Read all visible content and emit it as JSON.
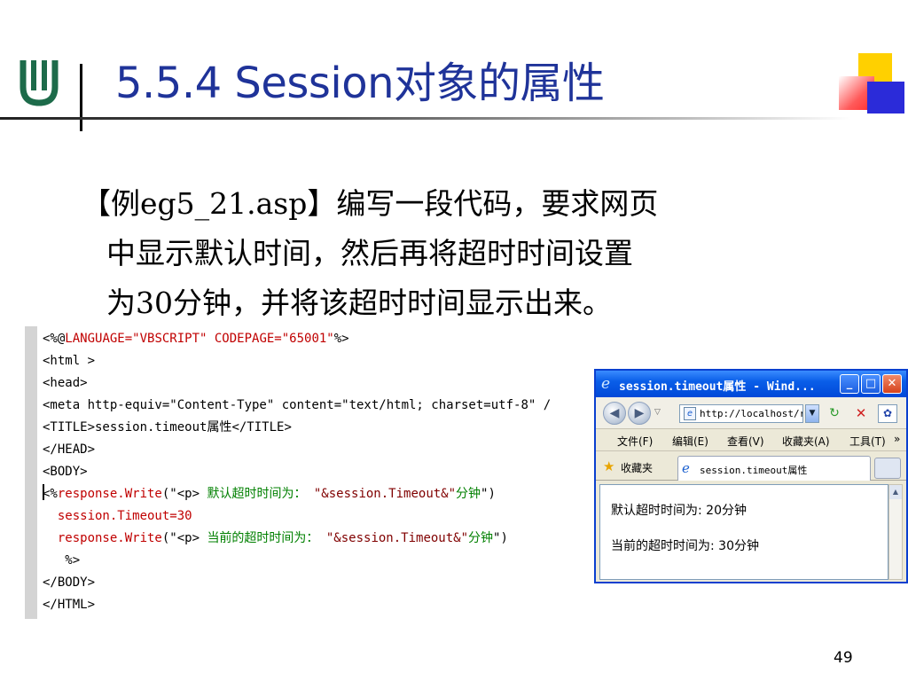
{
  "slide": {
    "title": "5.5.4 Session对象的属性",
    "page_number": "49"
  },
  "body": {
    "lines": [
      "【例eg5_21.asp】编写一段代码，要求网页",
      "中显示默认时间，然后再将超时时间设置",
      "为30分钟，并将该超时时间显示出来。"
    ]
  },
  "code": {
    "line1_a": "<%@",
    "line1_b": "LANGUAGE=\"VBSCRIPT\" CODEPAGE=\"65001\"",
    "line1_c": "%>",
    "line2": "<html >",
    "line3": "<head>",
    "line4": "<meta http-equiv=\"Content-Type\" content=\"text/html; charset=utf-8\" /",
    "line5_a": "<TITLE>session.timeout",
    "line5_b": "属性",
    "line5_c": "</TITLE>",
    "line6": "</HEAD>",
    "line7": "<BODY>",
    "line8_a": "<%",
    "line8_b": "response.Write",
    "line8_c": "(\"<p> ",
    "line8_d": "默认超时时间为：",
    "line8_e": " \"&session.Timeout&\"",
    "line8_f": "分钟",
    "line8_g": "\")",
    "line9_a": "  session.Timeout=",
    "line9_b": "30",
    "line10_a": "  response.Write",
    "line10_b": "(\"<p> ",
    "line10_c": "当前的超时时间为：",
    "line10_d": " \"&session.Timeout&\"",
    "line10_e": "分钟",
    "line10_f": "\")",
    "line11": "   %>",
    "line12": "</BODY>",
    "line13": "</HTML>"
  },
  "browser": {
    "title": "session.timeout属性 - Wind...",
    "address": "http://localhost/r",
    "menu": {
      "file": "文件(F)",
      "edit": "编辑(E)",
      "view": "查看(V)",
      "favorites": "收藏夹(A)",
      "tools": "工具(T)",
      "more": "»"
    },
    "favorites_label": "收藏夹",
    "tab_title": "session.timeout属性",
    "content_line1": "默认超时时间为: 20分钟",
    "content_line2": "当前的超时时间为: 30分钟"
  },
  "colors": {
    "title": "#1f3399",
    "code_keyword": "#c00000",
    "code_chinese": "#008000",
    "xp_title_blue": "#0a5ee8"
  }
}
